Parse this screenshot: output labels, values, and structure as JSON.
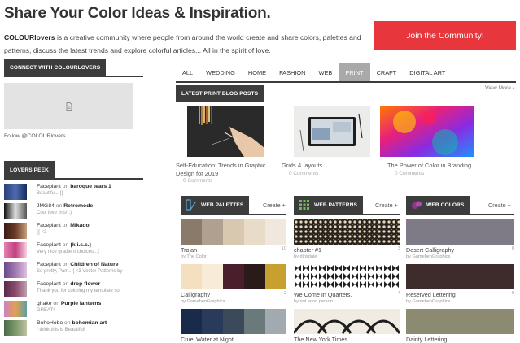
{
  "header": {
    "title": "Share Your Color Ideas & Inspiration.",
    "intro_brand": "COLOURlovers",
    "intro_text": " is a creative community where people from around the world create and share colors, palettes and patterns, discuss the latest trends and explore colorful articles... All in the spirit of love.",
    "join_label": "Join the Community!"
  },
  "sidebar": {
    "connect_title": "CONNECT WITH COLOURLOVERS",
    "follow_text": "Follow @COLOURlovers",
    "peek_title": "LOVERS PEEK",
    "lovers": [
      {
        "user": "Faceplant",
        "on": " on ",
        "item": "baroque tears 1",
        "comment": "Beautiful...{{",
        "colors": [
          "#2c3e7a",
          "#4a6db0",
          "#1a2a5a"
        ]
      },
      {
        "user": "JMG84",
        "on": " on ",
        "item": "Retromode",
        "comment": "Cool love this! :)",
        "colors": [
          "#111111",
          "#dddddd",
          "#555555"
        ]
      },
      {
        "user": "Faceplant",
        "on": " on ",
        "item": "Mikado",
        "comment": "{{ <3",
        "colors": [
          "#3a1c16",
          "#6b3a28",
          "#c8a07a"
        ]
      },
      {
        "user": "Faceplant",
        "on": " on ",
        "item": "{k.i.s.s.}",
        "comment": "Very nice gradient choices...{",
        "colors": [
          "#e87fb0",
          "#c04080",
          "#fbd0e0"
        ]
      },
      {
        "user": "Faceplant",
        "on": " on ",
        "item": "Children of Nature",
        "comment": "So pretty, Pam...{ <3 Vector Patterns by",
        "colors": [
          "#6a4a8a",
          "#a07ab0",
          "#e0c0e0"
        ]
      },
      {
        "user": "Faceplant",
        "on": " on ",
        "item": "drop flower",
        "comment": "Thank you for coloring my template so",
        "colors": [
          "#5a2a4a",
          "#8a4a6a",
          "#c0a0b0"
        ]
      },
      {
        "user": "ghake",
        "on": " on ",
        "item": "Purple lanterns",
        "comment": "GREAT!",
        "colors": [
          "#d080c0",
          "#e0a050",
          "#60a0a0"
        ]
      },
      {
        "user": "BohoHobo",
        "on": " on ",
        "item": "bohemian art",
        "comment": "I think this is Beautiful!",
        "colors": [
          "#4a6a4a",
          "#7a9a6a",
          "#c0c0a0"
        ]
      }
    ]
  },
  "tabs": [
    {
      "label": "ALL",
      "active": false
    },
    {
      "label": "WEDDING",
      "active": false
    },
    {
      "label": "HOME",
      "active": false
    },
    {
      "label": "FASHION",
      "active": false
    },
    {
      "label": "WEB",
      "active": false
    },
    {
      "label": "PRINT",
      "active": true
    },
    {
      "label": "CRAFT",
      "active": false
    },
    {
      "label": "DIGITAL ART",
      "active": false
    }
  ],
  "blog": {
    "title": "LATEST PRINT BLOG POSTS",
    "view_more": "View More ›",
    "posts": [
      {
        "caption": "Self-Education: Trends in Graphic Design for 2019",
        "comments": "0 Comments"
      },
      {
        "caption": "Grids & layouts",
        "comments": "0 Comments"
      },
      {
        "caption": "The Power of Color in Branding",
        "comments": "0 Comments"
      }
    ]
  },
  "sections": [
    {
      "title": "WEB PALETTES",
      "create": "Create +",
      "icon": "palette-icon",
      "items": [
        {
          "title": "Trojan",
          "by": "by The Color",
          "num": "10",
          "colors": [
            "#8a7a6a",
            "#b0a090",
            "#d8c8b0",
            "#e8dcc8",
            "#f0e8dc"
          ]
        },
        {
          "title": "Calligraphy",
          "by": "by GamehenGraphics",
          "num": "2",
          "colors": [
            "#f4e0c0",
            "#f8ecd8",
            "#4a1e2a",
            "#2a1a1a",
            "#c8a030"
          ]
        },
        {
          "title": "Cruel Water at Night",
          "by": "",
          "num": "",
          "colors": [
            "#1a2a4a",
            "#2a3a5a",
            "#3a4a5a",
            "#6a7a7a",
            "#a0aab0"
          ]
        }
      ]
    },
    {
      "title": "WEB PATTERNS",
      "create": "Create +",
      "icon": "pattern-grid-icon",
      "items": [
        {
          "title": "chapter #1",
          "by": "by dinsdale",
          "num": "3"
        },
        {
          "title": "We Come In Quartets.",
          "by": "by not.anon.person",
          "num": "4"
        },
        {
          "title": "The New York Times.",
          "by": "",
          "num": ""
        }
      ]
    },
    {
      "title": "WEB COLORS",
      "create": "Create +",
      "icon": "color-drop-icon",
      "items": [
        {
          "title": "Desert Calligraphy",
          "by": "by GamehenGraphics",
          "num": "0",
          "color": "#7e7a86"
        },
        {
          "title": "Reserved Lettering",
          "by": "by GamehenGraphics",
          "num": "0",
          "color": "#3e2b2b"
        },
        {
          "title": "Dainty Lettering",
          "by": "",
          "num": "",
          "color": "#8c8a70"
        }
      ]
    }
  ]
}
